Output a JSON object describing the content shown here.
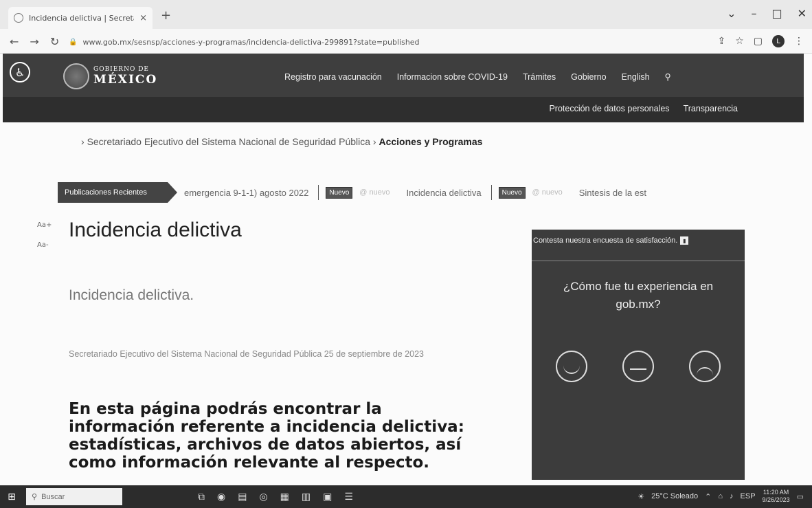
{
  "browser": {
    "tab_title": "Incidencia delictiva | Secretaria",
    "tab_close": "×",
    "new_tab": "+",
    "url": "www.gob.mx/sesnsp/acciones-y-programas/incidencia-delictiva-299891?state=published",
    "window_controls": [
      "⌄",
      "–",
      "□",
      "✕"
    ],
    "profile_initial": "L"
  },
  "header": {
    "gov_line1": "GOBIERNO DE",
    "gov_line2": "MÉXICO",
    "nav": [
      "Registro para vacunación",
      "Informacion sobre COVID-19",
      "Trámites",
      "Gobierno",
      "English"
    ],
    "subnav": [
      "Protección de datos personales",
      "Transparencia"
    ]
  },
  "breadcrumb": {
    "parent": "Secretariado Ejecutivo del Sistema Nacional de Seguridad Pública",
    "current": "Acciones y Programas"
  },
  "ticker": {
    "label": "Publicaciones Recientes",
    "items": [
      {
        "text": "emergencia 9-1-1) agosto 2022",
        "badge": "Nuevo",
        "faint": "@ nuevo"
      },
      {
        "text": "Incidencia delictiva",
        "badge": "Nuevo",
        "faint": "@ nuevo"
      },
      {
        "text": "Sintesis de la est",
        "badge": "",
        "faint": ""
      }
    ]
  },
  "font_controls": {
    "increase": "Aa+",
    "decrease": "Aa-"
  },
  "article": {
    "title": "Incidencia delictiva",
    "subtitle": "Incidencia delictiva.",
    "meta": "Secretariado Ejecutivo del Sistema Nacional de Seguridad Pública   25 de septiembre de 2023",
    "lead": "En esta página podrás encontrar la información referente a incidencia delictiva: estadísticas, archivos de datos abiertos, así como información relevante al respecto."
  },
  "survey": {
    "header": "Contesta nuestra encuesta de satisfacción.",
    "question": "¿Cómo fue tu experiencia en gob.mx?"
  },
  "taskbar": {
    "search_placeholder": "Buscar",
    "weather": "25°C Soleado",
    "lang": "ESP",
    "time": "11:20 AM",
    "date": "9/26/2023"
  }
}
